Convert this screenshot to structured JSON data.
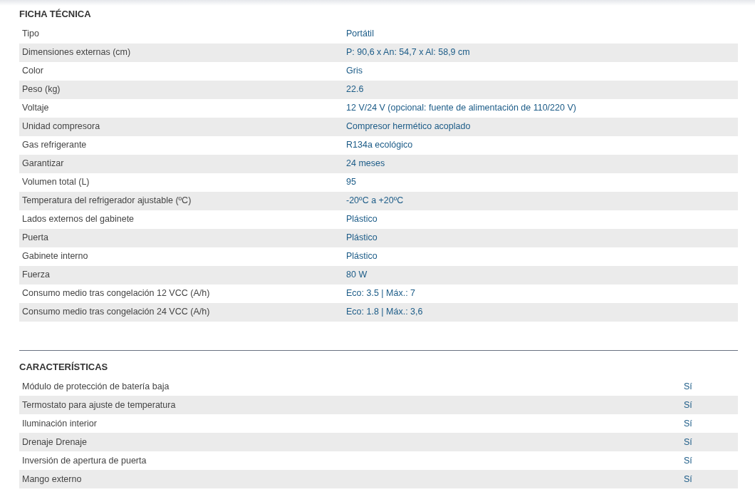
{
  "sections": [
    {
      "title": "FICHA TÉCNICA",
      "kind": "specs",
      "rows": [
        {
          "label": "Tipo",
          "value": "Portátil"
        },
        {
          "label": "Dimensiones externas (cm)",
          "value": "P: 90,6 x An: 54,7 x Al: 58,9 cm"
        },
        {
          "label": "Color",
          "value": "Gris"
        },
        {
          "label": "Peso (kg)",
          "value": "22.6"
        },
        {
          "label": "Voltaje",
          "value": "12 V/24 V (opcional: fuente de alimentación de 110/220 V)"
        },
        {
          "label": "Unidad compresora",
          "value": "Compresor hermético acoplado"
        },
        {
          "label": "Gas refrigerante",
          "value": "R134a ecológico"
        },
        {
          "label": "Garantizar",
          "value": "24 meses"
        },
        {
          "label": "Volumen total (L)",
          "value": "95"
        },
        {
          "label": "Temperatura del refrigerador ajustable (ºC)",
          "value": "-20ºC a +20ºC"
        },
        {
          "label": "Lados externos del gabinete",
          "value": "Plástico"
        },
        {
          "label": "Puerta",
          "value": "Plástico"
        },
        {
          "label": "Gabinete interno",
          "value": "Plástico"
        },
        {
          "label": "Fuerza",
          "value": "80 W"
        },
        {
          "label": "Consumo medio tras congelación 12 VCC (A/h)",
          "value": "Eco: 3.5 | Máx.: 7"
        },
        {
          "label": "Consumo medio tras congelación 24 VCC (A/h)",
          "value": "Eco: 1.8 | Máx.: 3,6"
        }
      ]
    },
    {
      "title": "CARACTERÍSTICAS",
      "kind": "features",
      "rows": [
        {
          "label": "Módulo de protección de batería baja",
          "value": "Sí"
        },
        {
          "label": "Termostato para ajuste de temperatura",
          "value": "Sí"
        },
        {
          "label": "Iluminación interior",
          "value": "Sí"
        },
        {
          "label": "Drenaje Drenaje",
          "value": "Sí"
        },
        {
          "label": "Inversión de apertura de puerta",
          "value": "Sí"
        },
        {
          "label": "Mango externo",
          "value": "Sí"
        }
      ]
    }
  ]
}
